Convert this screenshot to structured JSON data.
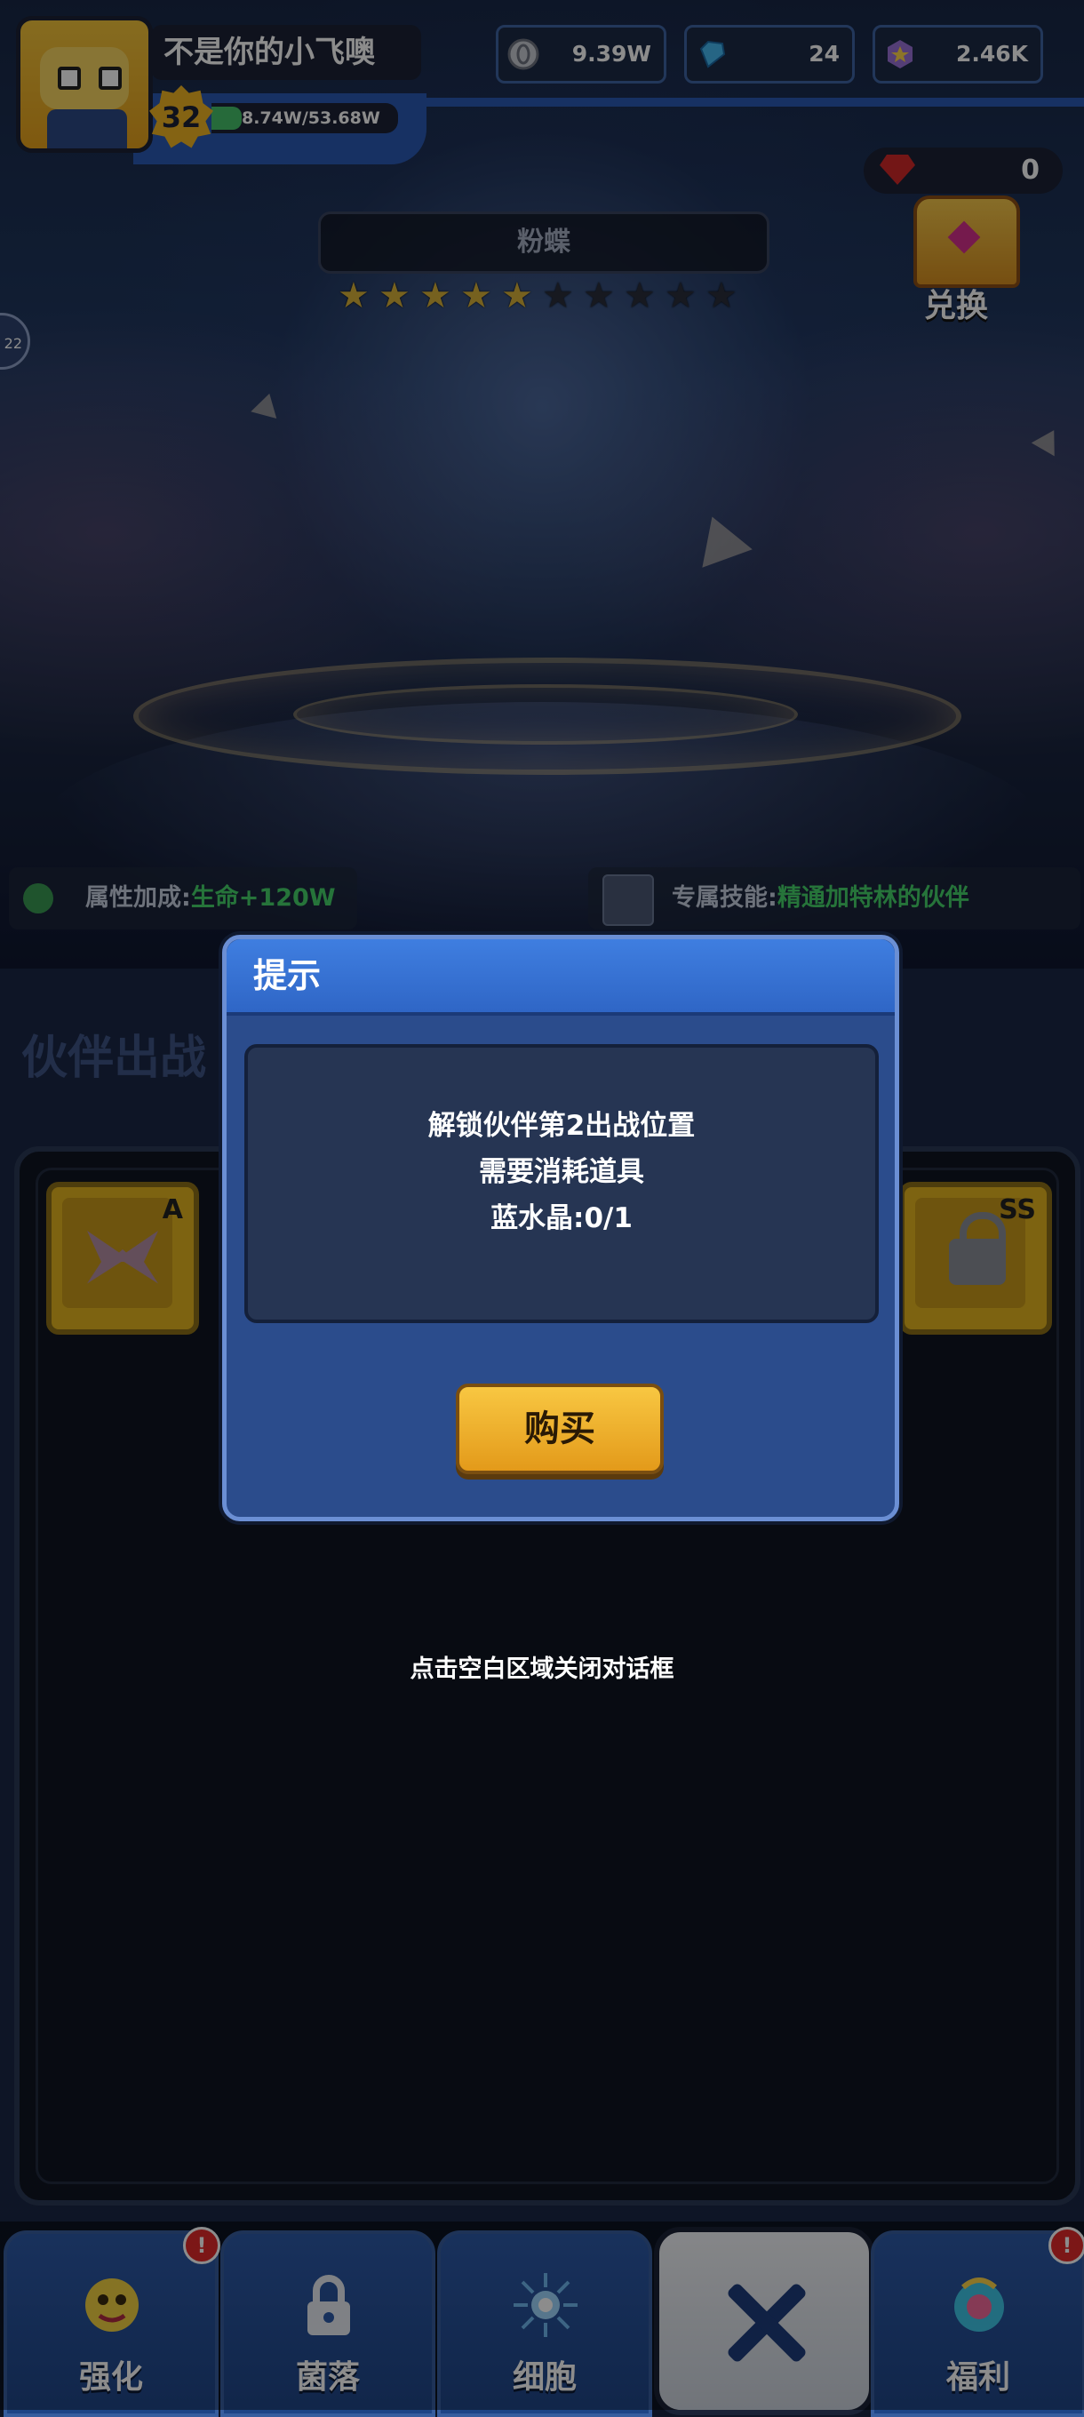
{
  "player": {
    "name": "不是你的小飞噢",
    "level": "32",
    "xp": "8.74W/53.68W",
    "xp_progress": 0.163
  },
  "resources": {
    "coins": "9.39W",
    "diamonds": "24",
    "crystals": "2.46K",
    "rubies": "0"
  },
  "exchange": {
    "label": "兑换"
  },
  "partner": {
    "name": "粉蝶",
    "stars_filled": 5,
    "stars_total": 10
  },
  "attributes": {
    "bonus_label": "属性加成:",
    "bonus_value": "生命+120W",
    "skill_label": "专属技能:",
    "skill_value": "精通加特林的伙伴"
  },
  "section": {
    "title": "伙伴出战"
  },
  "slots": [
    {
      "grade": "A",
      "state": "butterfly"
    },
    {
      "grade": "SS",
      "state": "locked"
    }
  ],
  "dialog": {
    "title": "提示",
    "line1": "解锁伙伴第2出战位置",
    "line2": "需要消耗道具",
    "line3": "蓝水晶:0/1",
    "buy_label": "购买"
  },
  "hint": "点击空白区域关闭对话框",
  "side_circle": "22",
  "nav": [
    {
      "label": "强化",
      "icon": "enhance-mascot-icon",
      "badge": "!"
    },
    {
      "label": "菌落",
      "icon": "lock-icon"
    },
    {
      "label": "细胞",
      "icon": "cell-burst-icon"
    },
    {
      "label": "",
      "icon": "close-x-icon"
    },
    {
      "label": "福利",
      "icon": "gift-orb-icon",
      "badge": "!"
    }
  ]
}
